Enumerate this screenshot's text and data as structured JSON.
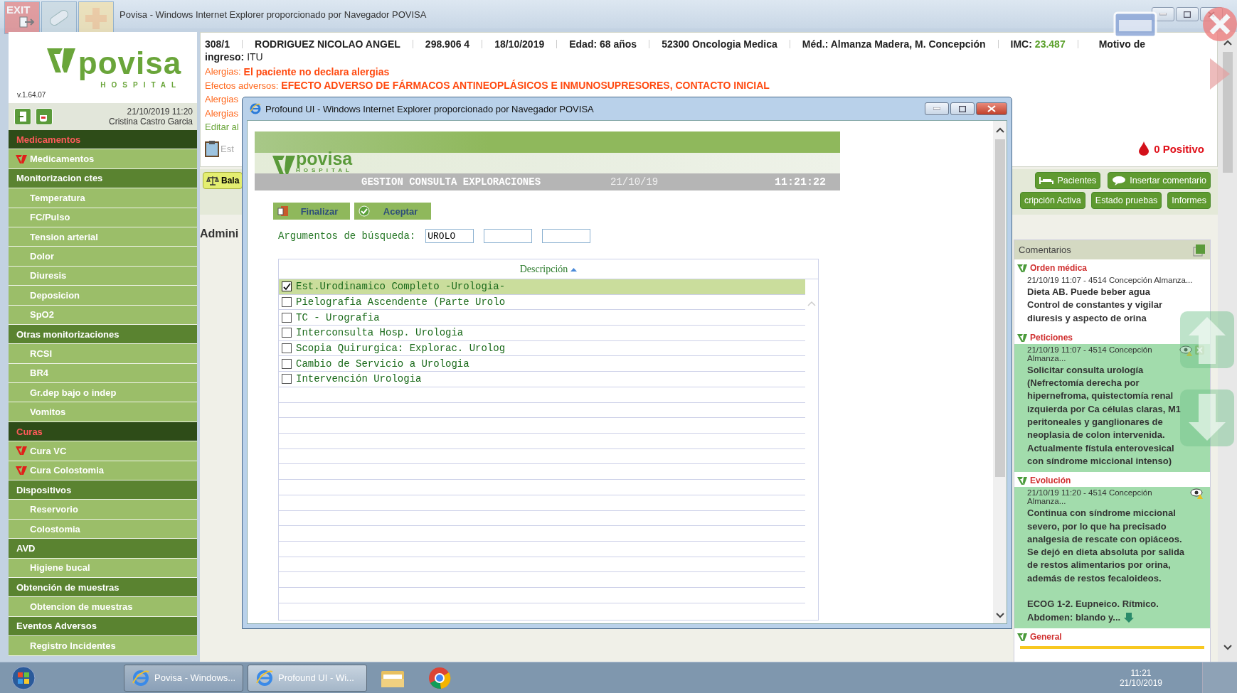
{
  "outer_window": {
    "title": "Povisa - Windows Internet Explorer proporcionado por Navegador POVISA"
  },
  "quick_icons": [
    {
      "kind": "exit",
      "label": "EXIT"
    },
    {
      "kind": "pill"
    },
    {
      "kind": "plus"
    }
  ],
  "sidebar": {
    "logo": {
      "name": "povisa",
      "subtitle": "HOSPITAL"
    },
    "version": "v.1.64.07",
    "date": "21/10/2019  11:20",
    "user": "Cristina Castro Garcia",
    "items": [
      {
        "label": "Medicamentos",
        "kind": "header",
        "alert": true
      },
      {
        "label": "Medicamentos",
        "kind": "item",
        "flagged": true
      },
      {
        "label": "Monitorizacion ctes",
        "kind": "header",
        "alert": false
      },
      {
        "label": "Temperatura",
        "kind": "item",
        "flagged": false
      },
      {
        "label": "FC/Pulso",
        "kind": "item",
        "flagged": false
      },
      {
        "label": "Tension arterial",
        "kind": "item",
        "flagged": false
      },
      {
        "label": "Dolor",
        "kind": "item",
        "flagged": false
      },
      {
        "label": "Diuresis",
        "kind": "item",
        "flagged": false
      },
      {
        "label": "Deposicion",
        "kind": "item",
        "flagged": false
      },
      {
        "label": "SpO2",
        "kind": "item",
        "flagged": false
      },
      {
        "label": "Otras monitorizaciones",
        "kind": "header",
        "alert": false
      },
      {
        "label": "RCSI",
        "kind": "item",
        "flagged": false
      },
      {
        "label": "BR4",
        "kind": "item",
        "flagged": false
      },
      {
        "label": "Gr.dep bajo o indep",
        "kind": "item",
        "flagged": false
      },
      {
        "label": "Vomitos",
        "kind": "item",
        "flagged": false
      },
      {
        "label": "Curas",
        "kind": "header",
        "alert": true
      },
      {
        "label": "Cura VC",
        "kind": "item",
        "flagged": true
      },
      {
        "label": "Cura Colostomia",
        "kind": "item",
        "flagged": true
      },
      {
        "label": "Dispositivos",
        "kind": "header",
        "alert": false
      },
      {
        "label": "Reservorio",
        "kind": "item",
        "flagged": false
      },
      {
        "label": "Colostomia",
        "kind": "item",
        "flagged": false
      },
      {
        "label": "AVD",
        "kind": "header",
        "alert": false
      },
      {
        "label": "Higiene bucal",
        "kind": "item",
        "flagged": false
      },
      {
        "label": "Obtención de muestras",
        "kind": "header",
        "alert": false
      },
      {
        "label": "Obtencion de muestras",
        "kind": "item",
        "flagged": false
      },
      {
        "label": "Eventos Adversos",
        "kind": "header",
        "alert": false
      },
      {
        "label": "Registro Incidentes",
        "kind": "item",
        "flagged": false
      }
    ]
  },
  "patient_bar": {
    "fields": [
      "308/1",
      "RODRIGUEZ NICOLAO ANGEL",
      "298.906 4",
      "18/10/2019",
      "Edad: 68 años",
      "52300 Oncologia Medica",
      "Méd.: Almanza Madera, M. Concepción"
    ],
    "imc": {
      "label": "IMC:",
      "value": "23.487"
    },
    "reason": {
      "label_start": "Motivo de",
      "label_end": "ingreso:",
      "value": "ITU"
    }
  },
  "alerts": [
    {
      "label": "Alergias:",
      "value": "El paciente no declara alergias"
    },
    {
      "label": "Efectos adversos:",
      "value": "EFECTO ADVERSO DE FÁRMACOS ANTINEOPLÁSICOS E INMUNOSUPRESORES, CONTACTO INICIAL"
    },
    {
      "label": "Alergias"
    },
    {
      "label": "Alergias"
    }
  ],
  "edit_link": "Editar al",
  "status_label": "Est",
  "blood_group": "0 Positivo",
  "toolbar": {
    "left": [
      {
        "label": "Bala"
      }
    ],
    "rows": [
      [
        {
          "label": "Pacientes"
        },
        {
          "label": "Insertar comentario"
        }
      ],
      [
        {
          "label": "cripción Activa"
        },
        {
          "label": "Estado pruebas"
        },
        {
          "label": "Informes"
        }
      ]
    ]
  },
  "section_title": "Admini",
  "comments": {
    "title": "Comentarios",
    "sections": [
      {
        "title": "Orden médica",
        "highlighted": false,
        "viewable": false,
        "removable": false,
        "truncated": false,
        "meta": "21/10/19 11:07 - 4514 Concepción Almanza...",
        "body": "Dieta AB. Puede beber agua\nControl de constantes y vigilar\ndiuresis y aspecto de orina"
      },
      {
        "title": "Peticiones",
        "highlighted": true,
        "viewable": true,
        "removable": true,
        "truncated": false,
        "meta": "21/10/19 11:07 - 4514 Concepción Almanza...",
        "body": "Solicitar consulta urología\n(Nefrectomía derecha por\nhipernefroma, quistectomía renal\nizquierda por Ca células claras, M1\nperitoneales y ganglionares de\nneoplasia de colon intervenida.\nActualmente fístula enterovesical\ncon síndrome miccional intenso)"
      },
      {
        "title": "Evolución",
        "highlighted": true,
        "viewable": true,
        "removable": false,
        "truncated": true,
        "meta": "21/10/19 11:20 - 4514 Concepción Almanza...",
        "body": "Continua con síndrome miccional\nsevero, por lo que ha precisado\nanalgesia de rescate con opiáceos.\nSe dejó en dieta absoluta por salida\nde restos alimentarios por orina,\nademás de restos fecaloideos.\n\nECOG 1-2. Eupneico. Rítmico.\nAbdomen: blando y..."
      },
      {
        "title": "General"
      }
    ]
  },
  "dialog": {
    "title": "Profound UI - Windows Internet Explorer proporcionado por Navegador POVISA",
    "banner": {
      "logo": "povisa",
      "logo_sub": "HOSPITAL",
      "heading": "GESTION CONSULTA EXPLORACIONES",
      "date": "21/10/19",
      "time": "11:21:22"
    },
    "buttons": [
      {
        "label": "Finalizar"
      },
      {
        "label": "Aceptar"
      }
    ],
    "search": {
      "label": "Argumentos de búsqueda:",
      "value": "UROLO"
    },
    "table": {
      "column": "Descripción",
      "rows": [
        {
          "text": "Est.Urodinamico Completo -Urologia-",
          "checked": true,
          "selected": true
        },
        {
          "text": "Pielografia Ascendente (Parte Urolo",
          "checked": false,
          "selected": false
        },
        {
          "text": "TC - Urografia",
          "checked": false,
          "selected": false
        },
        {
          "text": "Interconsulta Hosp. Urologia",
          "checked": false,
          "selected": false
        },
        {
          "text": "Scopia Quirurgica: Explorac. Urolog",
          "checked": false,
          "selected": false
        },
        {
          "text": "Cambio de Servicio a Urologia",
          "checked": false,
          "selected": false
        },
        {
          "text": "Intervención Urologia",
          "checked": false,
          "selected": false
        }
      ]
    }
  },
  "taskbar": {
    "tasks": [
      {
        "label": "Povisa - Windows...",
        "selected": false
      },
      {
        "label": "Profound UI - Wi...",
        "selected": true
      }
    ],
    "pinned": [
      {
        "kind": "folder"
      },
      {
        "kind": "browser"
      }
    ],
    "time": "11:21",
    "date": "21/10/2019"
  }
}
